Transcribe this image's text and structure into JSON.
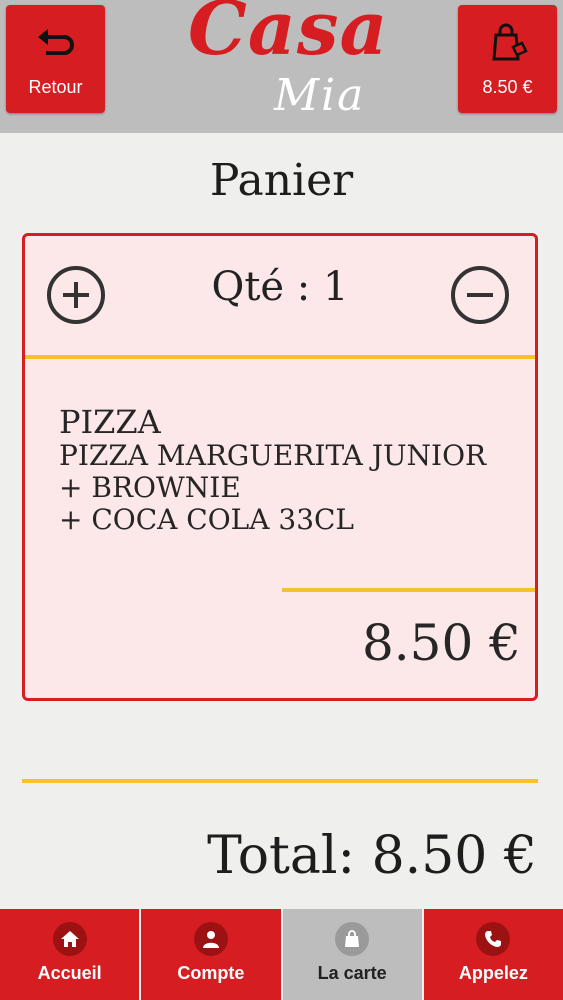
{
  "header": {
    "back_label": "Retour",
    "cart_amount": "8.50 €",
    "logo_main": "Casa",
    "logo_sub": "Mia"
  },
  "page": {
    "title": "Panier"
  },
  "cart_item": {
    "quantity_text": "Qté : 1",
    "lines": [
      "PIZZA",
      "PIZZA MARGUERITA JUNIOR",
      "+ BROWNIE",
      "+ COCA COLA 33CL"
    ],
    "price": "8.50 €"
  },
  "total": {
    "text": "Total: 8.50 €"
  },
  "nav": {
    "items": [
      {
        "label": "Accueil",
        "icon": "home-icon"
      },
      {
        "label": "Compte",
        "icon": "user-icon"
      },
      {
        "label": "La carte",
        "icon": "bag-icon"
      },
      {
        "label": "Appelez",
        "icon": "phone-icon"
      }
    ],
    "active_index": 2
  },
  "colors": {
    "brand_red": "#d61e22",
    "header_gray": "#bdbdbd",
    "card_bg": "#fce8e8",
    "separator_yellow": "#f3c22d"
  }
}
